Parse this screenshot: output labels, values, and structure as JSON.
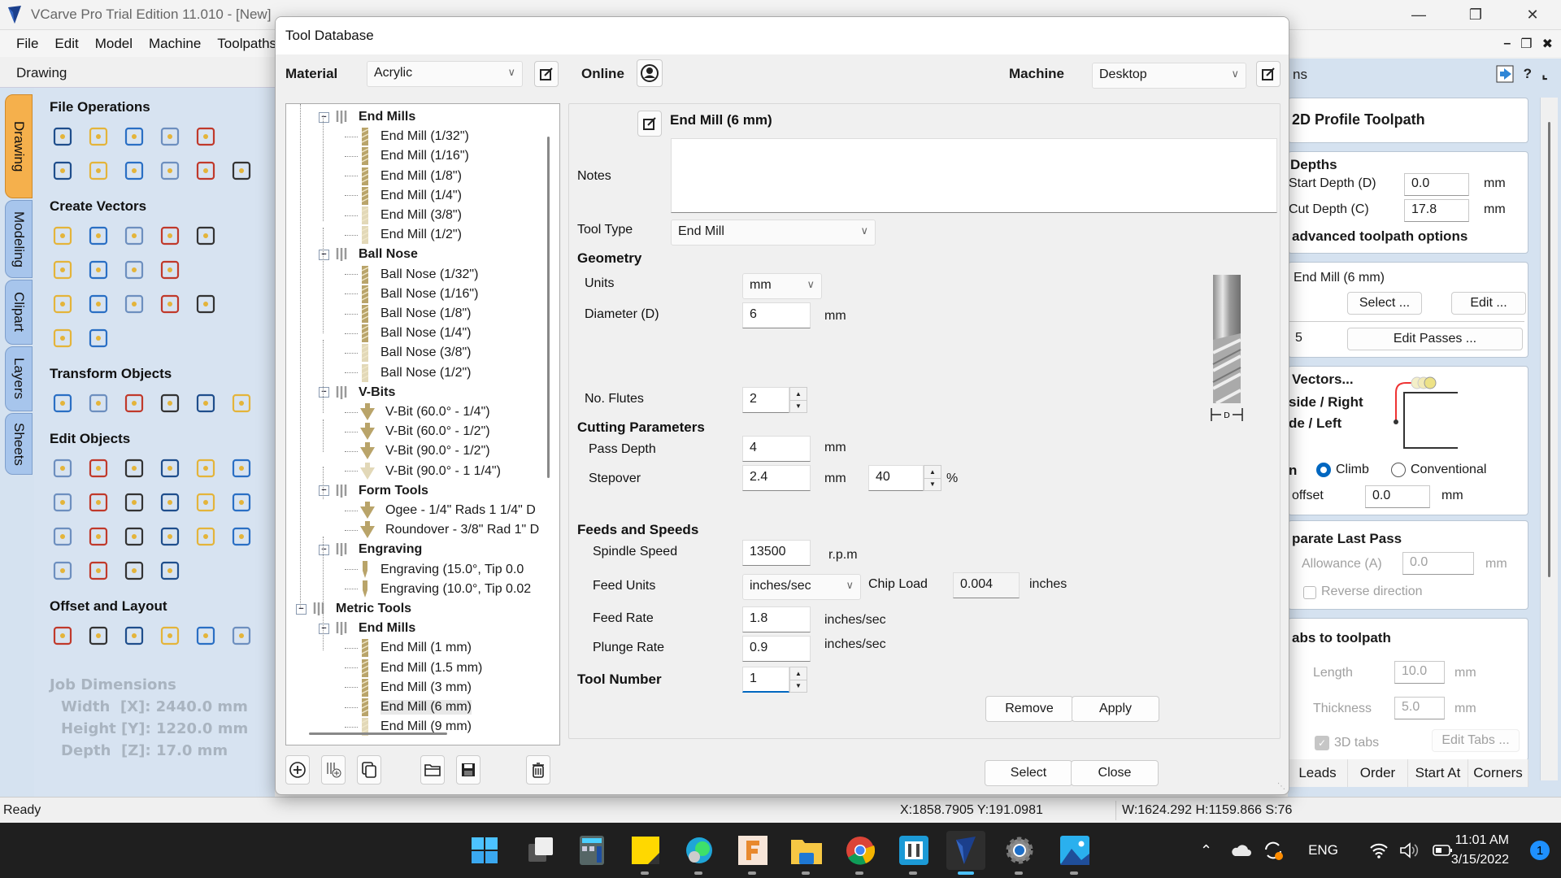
{
  "app": {
    "title": "VCarve Pro Trial Edition 11.010 - [New]",
    "menu": [
      "File",
      "Edit",
      "Model",
      "Machine",
      "Toolpaths"
    ]
  },
  "left_panel": {
    "header": "Drawing",
    "vertical_tabs": [
      {
        "label": "Drawing",
        "active": true
      },
      {
        "label": "Modeling",
        "active": false
      },
      {
        "label": "Clipart",
        "active": false
      },
      {
        "label": "Layers",
        "active": false
      },
      {
        "label": "Sheets",
        "active": false
      }
    ],
    "sections": [
      {
        "title": "File Operations",
        "rows": [
          [
            "new-file-icon",
            "open-file-icon",
            "save-file-icon",
            "import-vectors-icon",
            "import-bitmap-icon"
          ],
          [
            "job-setup-icon",
            "cut-icon",
            "copy-icon",
            "paste-icon",
            "undo-icon",
            "redo-icon"
          ]
        ]
      },
      {
        "title": "Create Vectors",
        "rows": [
          [
            "draw-circle-icon",
            "draw-ellipse-icon",
            "draw-rectangle-icon",
            "draw-polygon-icon",
            "draw-star-icon"
          ],
          [
            "draw-polyline-icon",
            "draw-curve-icon",
            "draw-arc-icon",
            "fill-pattern-icon"
          ],
          [
            "draw-text-icon",
            "auto-layout-text-icon",
            "text-on-curve-icon",
            "adjust-text-spacing-icon",
            "arc-text-icon"
          ],
          [
            "trace-bitmap-icon",
            "dimension-icon"
          ]
        ]
      },
      {
        "title": "Transform Objects",
        "rows": [
          [
            "move-icon",
            "set-size-icon",
            "align-icon",
            "mirror-icon",
            "distort-icon",
            "center-in-material-icon"
          ]
        ]
      },
      {
        "title": "Edit Objects",
        "rows": [
          [
            "select-icon",
            "node-edit-icon",
            "transform-icon",
            "group-icon",
            "ungroup-icon",
            "measure-icon"
          ],
          [
            "weld-icon",
            "subtract-icon",
            "intersect-icon",
            "hatch-icon",
            "trim-icon",
            "validate-icon"
          ],
          [
            "fillet-icon",
            "chamfer-icon",
            "smooth-icon",
            "join-vectors-icon",
            "edit-image-icon",
            "create-boundary-icon"
          ],
          [
            "curve-fit-icon",
            "extend-icon",
            "smooth-corner-icon",
            "tangent-icon"
          ]
        ]
      },
      {
        "title": "Offset and Layout",
        "rows": [
          [
            "offset-icon",
            "array-copy-icon",
            "circular-array-icon",
            "copy-along-vectors-icon",
            "nesting-icon",
            "zig-zag-icon"
          ]
        ]
      }
    ],
    "job_dimensions": {
      "title": "Job Dimensions",
      "width": "Width  [X]: 2440.0 mm",
      "height": "Height [Y]: 1220.0 mm",
      "depth": "Depth  [Z]: 17.0 mm"
    }
  },
  "right_panel": {
    "header_partial": "ns",
    "title": "2D Profile Toolpath",
    "depths": {
      "heading": "Depths",
      "start_label": "Start Depth (D)",
      "start_value": "0.0",
      "start_unit": "mm",
      "cut_label": "Cut Depth (C)",
      "cut_value": "17.8",
      "cut_unit": "mm",
      "advanced": "advanced toolpath options"
    },
    "tool": {
      "name": "End Mill (6 mm)",
      "select_label": "Select ...",
      "edit_label": "Edit ...",
      "passes": "5",
      "edit_passes_label": "Edit Passes ..."
    },
    "machine_vectors": {
      "heading": "Vectors...",
      "outside": "side / Right",
      "inside": "de / Left",
      "direction_partial": "n",
      "climb": "Climb",
      "climb_selected": true,
      "conventional": "Conventional",
      "offset_label": "offset",
      "offset_value": "0.0",
      "offset_unit": "mm"
    },
    "last_pass": {
      "heading": "parate Last Pass",
      "allowance_label": "Allowance (A)",
      "allowance_value": "0.0",
      "allowance_unit": "mm",
      "reverse_label": "Reverse direction",
      "reverse_checked": false
    },
    "tabs_section": {
      "heading": "abs to toolpath",
      "length_label": "Length",
      "length_value": "10.0",
      "length_unit": "mm",
      "thickness_label": "Thickness",
      "thickness_value": "5.0",
      "thickness_unit": "mm",
      "tabs3d_label": "3D tabs",
      "tabs3d_checked": true,
      "edit_tabs_label": "Edit Tabs ..."
    },
    "bottom_tabs": [
      "Leads",
      "Order",
      "Start At",
      "Corners"
    ]
  },
  "status_bar": {
    "ready": "Ready",
    "cursor": "X:1858.7905 Y:191.0981",
    "dims": "W:1624.292   H:1159.866  S:76"
  },
  "dialog": {
    "title": "Tool Database",
    "material_label": "Material",
    "material_value": "Acrylic",
    "online_label": "Online",
    "machine_label": "Machine",
    "machine_value": "Desktop",
    "tree": [
      {
        "label": "End Mills",
        "level": 1,
        "type": "group"
      },
      {
        "label": "End Mill (1/32\")",
        "level": 2,
        "type": "endmill"
      },
      {
        "label": "End Mill (1/16\")",
        "level": 2,
        "type": "endmill"
      },
      {
        "label": "End Mill (1/8\")",
        "level": 2,
        "type": "endmill"
      },
      {
        "label": "End Mill (1/4\")",
        "level": 2,
        "type": "endmill"
      },
      {
        "label": "End Mill (3/8\")",
        "level": 2,
        "type": "endmill-light"
      },
      {
        "label": "End Mill (1/2\")",
        "level": 2,
        "type": "endmill-light"
      },
      {
        "label": "Ball Nose",
        "level": 1,
        "type": "group"
      },
      {
        "label": "Ball Nose (1/32\")",
        "level": 2,
        "type": "endmill"
      },
      {
        "label": "Ball Nose (1/16\")",
        "level": 2,
        "type": "endmill"
      },
      {
        "label": "Ball Nose (1/8\")",
        "level": 2,
        "type": "endmill"
      },
      {
        "label": "Ball Nose (1/4\")",
        "level": 2,
        "type": "endmill"
      },
      {
        "label": "Ball Nose (3/8\")",
        "level": 2,
        "type": "endmill-light"
      },
      {
        "label": "Ball Nose (1/2\")",
        "level": 2,
        "type": "endmill-light"
      },
      {
        "label": "V-Bits",
        "level": 1,
        "type": "group"
      },
      {
        "label": "V-Bit (60.0° - 1/4\")",
        "level": 2,
        "type": "vbit"
      },
      {
        "label": "V-Bit (60.0° - 1/2\")",
        "level": 2,
        "type": "vbit"
      },
      {
        "label": "V-Bit (90.0° - 1/2\")",
        "level": 2,
        "type": "vbit"
      },
      {
        "label": "V-Bit (90.0° - 1 1/4\")",
        "level": 2,
        "type": "vbit-light"
      },
      {
        "label": "Form Tools",
        "level": 1,
        "type": "group"
      },
      {
        "label": "Ogee - 1/4\" Rads 1 1/4\" D",
        "level": 2,
        "type": "vbit"
      },
      {
        "label": "Roundover - 3/8\" Rad 1\" D",
        "level": 2,
        "type": "vbit"
      },
      {
        "label": "Engraving",
        "level": 1,
        "type": "group"
      },
      {
        "label": "Engraving (15.0°, Tip 0.0",
        "level": 2,
        "type": "engrave"
      },
      {
        "label": "Engraving (10.0°, Tip 0.02",
        "level": 2,
        "type": "engrave"
      },
      {
        "label": "Metric Tools",
        "level": 0,
        "type": "group"
      },
      {
        "label": "End Mills",
        "level": 1,
        "type": "group"
      },
      {
        "label": "End Mill (1 mm)",
        "level": 2,
        "type": "endmill"
      },
      {
        "label": "End Mill (1.5 mm)",
        "level": 2,
        "type": "endmill"
      },
      {
        "label": "End Mill (3 mm)",
        "level": 2,
        "type": "endmill"
      },
      {
        "label": "End Mill (6 mm)",
        "level": 2,
        "type": "endmill",
        "selected": true
      },
      {
        "label": "End Mill (9 mm)",
        "level": 2,
        "type": "endmill-light"
      }
    ],
    "tree_toolbar": [
      "add-tool-icon",
      "add-group-icon",
      "copy-tool-icon",
      "import-icon",
      "save-icon",
      "delete-icon"
    ],
    "detail": {
      "tool_name": "End Mill (6 mm)",
      "notes_label": "Notes",
      "notes_value": "",
      "tool_type_label": "Tool Type",
      "tool_type_value": "End Mill",
      "geometry_heading": "Geometry",
      "units_label": "Units",
      "units_value": "mm",
      "diameter_label": "Diameter (D)",
      "diameter_value": "6",
      "diameter_unit": "mm",
      "flutes_label": "No. Flutes",
      "flutes_value": "2",
      "cutting_heading": "Cutting Parameters",
      "pass_depth_label": "Pass Depth",
      "pass_depth_value": "4",
      "pass_depth_unit": "mm",
      "stepover_label": "Stepover",
      "stepover_value": "2.4",
      "stepover_unit": "mm",
      "stepover_pct": "40",
      "pct_sign": "%",
      "feeds_heading": "Feeds and Speeds",
      "spindle_label": "Spindle Speed",
      "spindle_value": "13500",
      "spindle_unit": "r.p.m",
      "feed_units_label": "Feed Units",
      "feed_units_value": "inches/sec",
      "chip_load_label": "Chip Load",
      "chip_load_value": "0.004",
      "chip_load_unit": "inches",
      "feed_rate_label": "Feed Rate",
      "feed_rate_value": "1.8",
      "feed_rate_unit": "inches/sec",
      "plunge_label": "Plunge Rate",
      "plunge_value": "0.9",
      "plunge_unit": "inches/sec",
      "tool_number_label": "Tool Number",
      "tool_number_value": "1",
      "diagram_label": "D"
    },
    "buttons": {
      "remove": "Remove",
      "apply": "Apply",
      "select": "Select",
      "close": "Close"
    }
  },
  "taskbar": {
    "apps": [
      "start",
      "task-view",
      "calculator",
      "sticky-notes",
      "edge",
      "fusion-360",
      "file-explorer",
      "chrome",
      "brackets",
      "vcarve",
      "settings",
      "photos"
    ],
    "active_app": "vcarve",
    "language": "ENG",
    "time": "11:01 AM",
    "date": "3/15/2022",
    "notifications": "1"
  }
}
